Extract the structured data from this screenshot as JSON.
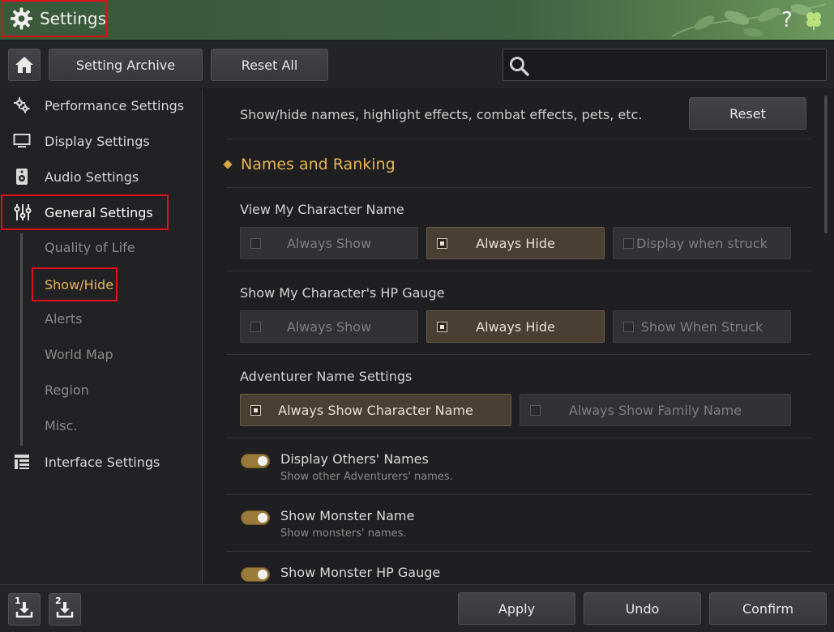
{
  "window": {
    "title": "Settings",
    "help_glyph": "?"
  },
  "toolbar": {
    "setting_archive": "Setting Archive",
    "reset_all": "Reset All",
    "search_value": ""
  },
  "sidebar": {
    "items": [
      {
        "label": "Performance Settings",
        "icon": "gears-icon"
      },
      {
        "label": "Display Settings",
        "icon": "monitor-icon"
      },
      {
        "label": "Audio Settings",
        "icon": "speaker-icon"
      },
      {
        "label": "General Settings",
        "icon": "sliders-icon"
      },
      {
        "label": "Interface Settings",
        "icon": "layout-icon"
      }
    ],
    "sub_items": [
      "Quality of Life",
      "Show/Hide",
      "Alerts",
      "World Map",
      "Region",
      "Misc."
    ]
  },
  "main": {
    "description": "Show/hide names, highlight effects, combat effects, pets, etc.",
    "reset_label": "Reset",
    "section_title": "Names and Ranking",
    "groups": [
      {
        "label": "View My Character Name",
        "options": [
          "Always Show",
          "Always Hide",
          "Display when struck"
        ],
        "selected": 1
      },
      {
        "label": "Show My Character's HP Gauge",
        "options": [
          "Always Show",
          "Always Hide",
          "Show When Struck"
        ],
        "selected": 1
      },
      {
        "label": "Adventurer Name Settings",
        "options": [
          "Always Show Character Name",
          "Always Show Family Name"
        ],
        "selected": 0
      }
    ],
    "toggles": [
      {
        "title": "Display Others' Names",
        "subtitle": "Show other Adventurers' names.",
        "on": true
      },
      {
        "title": "Show Monster Name",
        "subtitle": "Show monsters' names.",
        "on": true
      },
      {
        "title": "Show Monster HP Gauge",
        "subtitle": "",
        "on": true
      }
    ]
  },
  "footer": {
    "slot1": "1",
    "slot2": "2",
    "apply": "Apply",
    "undo": "Undo",
    "confirm": "Confirm"
  },
  "colors": {
    "accent_gold": "#e8b64a",
    "highlight_red": "#e0101a",
    "toggle_on": "#9a7a3a"
  }
}
